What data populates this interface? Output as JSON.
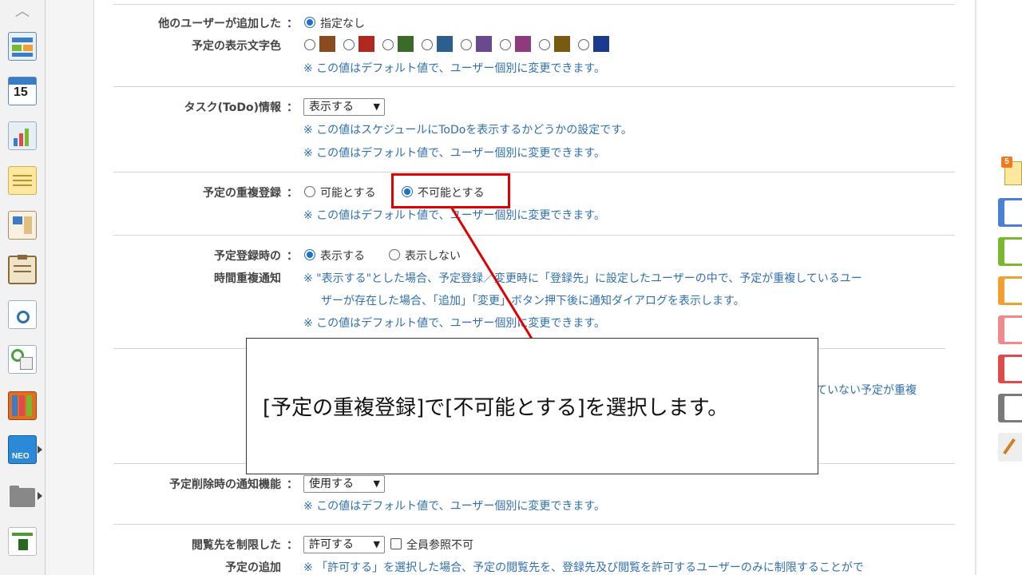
{
  "sidebar": {
    "icons": [
      "portal-icon",
      "calendar-icon",
      "chart-icon",
      "memo-icon",
      "bulletin-icon",
      "clipboard-icon",
      "search-doc-icon",
      "mail-icon",
      "books-icon",
      "neo-icon",
      "folder-icon",
      "app-icon"
    ],
    "calendar_day": "15",
    "neo_label": "NEO"
  },
  "settings": {
    "row1": {
      "label1": "他のユーザーが追加した",
      "label2": "予定の表示文字色",
      "radio_none": "指定なし",
      "colors": [
        "#8a4b1e",
        "#b0281e",
        "#3a6b2a",
        "#2a5f8f",
        "#6a4a8f",
        "#8f3a7a",
        "#7a5a10",
        "#1a3a8f"
      ],
      "note": "※ この値はデフォルト値で、ユーザー個別に変更できます。"
    },
    "row2": {
      "label": "タスク(ToDo)情報",
      "select_value": "表示する",
      "note1": "※ この値はスケジュールにToDoを表示するかどうかの設定です。",
      "note2": "※ この値はデフォルト値で、ユーザー個別に変更できます。"
    },
    "row3": {
      "label": "予定の重複登録",
      "option1": "可能とする",
      "option2": "不可能とする",
      "note": "※ この値はデフォルト値で、ユーザー個別に変更できます。"
    },
    "row4": {
      "label1": "予定登録時の",
      "label2": "時間重複通知",
      "option1": "表示する",
      "option2": "表示しない",
      "note1": "※ \"表示する\"とした場合、予定登録／変更時に「登録先」に設定したユーザーの中で、予定が重複しているユー",
      "note2": "ザーが存在した場合、「追加」「変更」ボタン押下後に通知ダイアログを表示します。",
      "note3": "※ この値はデフォルト値で、ユーザー個別に変更できます。"
    },
    "row5": {
      "note_partial": "ていない予定が重複"
    },
    "row6": {
      "label": "予定削除時の通知機能",
      "select_value": "使用する",
      "note": "※ この値はデフォルト値で、ユーザー個別に変更できます。"
    },
    "row7": {
      "label1": "閲覧先を制限した",
      "label2": "予定の追加",
      "select_value": "許可する",
      "checkbox_label": "全員参照不可",
      "note": "※ 「許可する」を選択した場合、予定の閲覧先を、登録先及び閲覧を許可するユーザーのみに制限することがで"
    },
    "colon": "："
  },
  "callout": {
    "text": "[予定の重複登録]で[不可能とする]を選択します。"
  },
  "right_tabs": {
    "badge": "5",
    "colors": [
      "#4a7fd4",
      "#7ab830",
      "#f0a030",
      "#f08a8a",
      "#e04a4a",
      "#7a7a7a"
    ]
  },
  "colors": {
    "highlight": "#e00000",
    "note_blue": "#2f6fb0",
    "radio_blue": "#1a6fd0"
  }
}
